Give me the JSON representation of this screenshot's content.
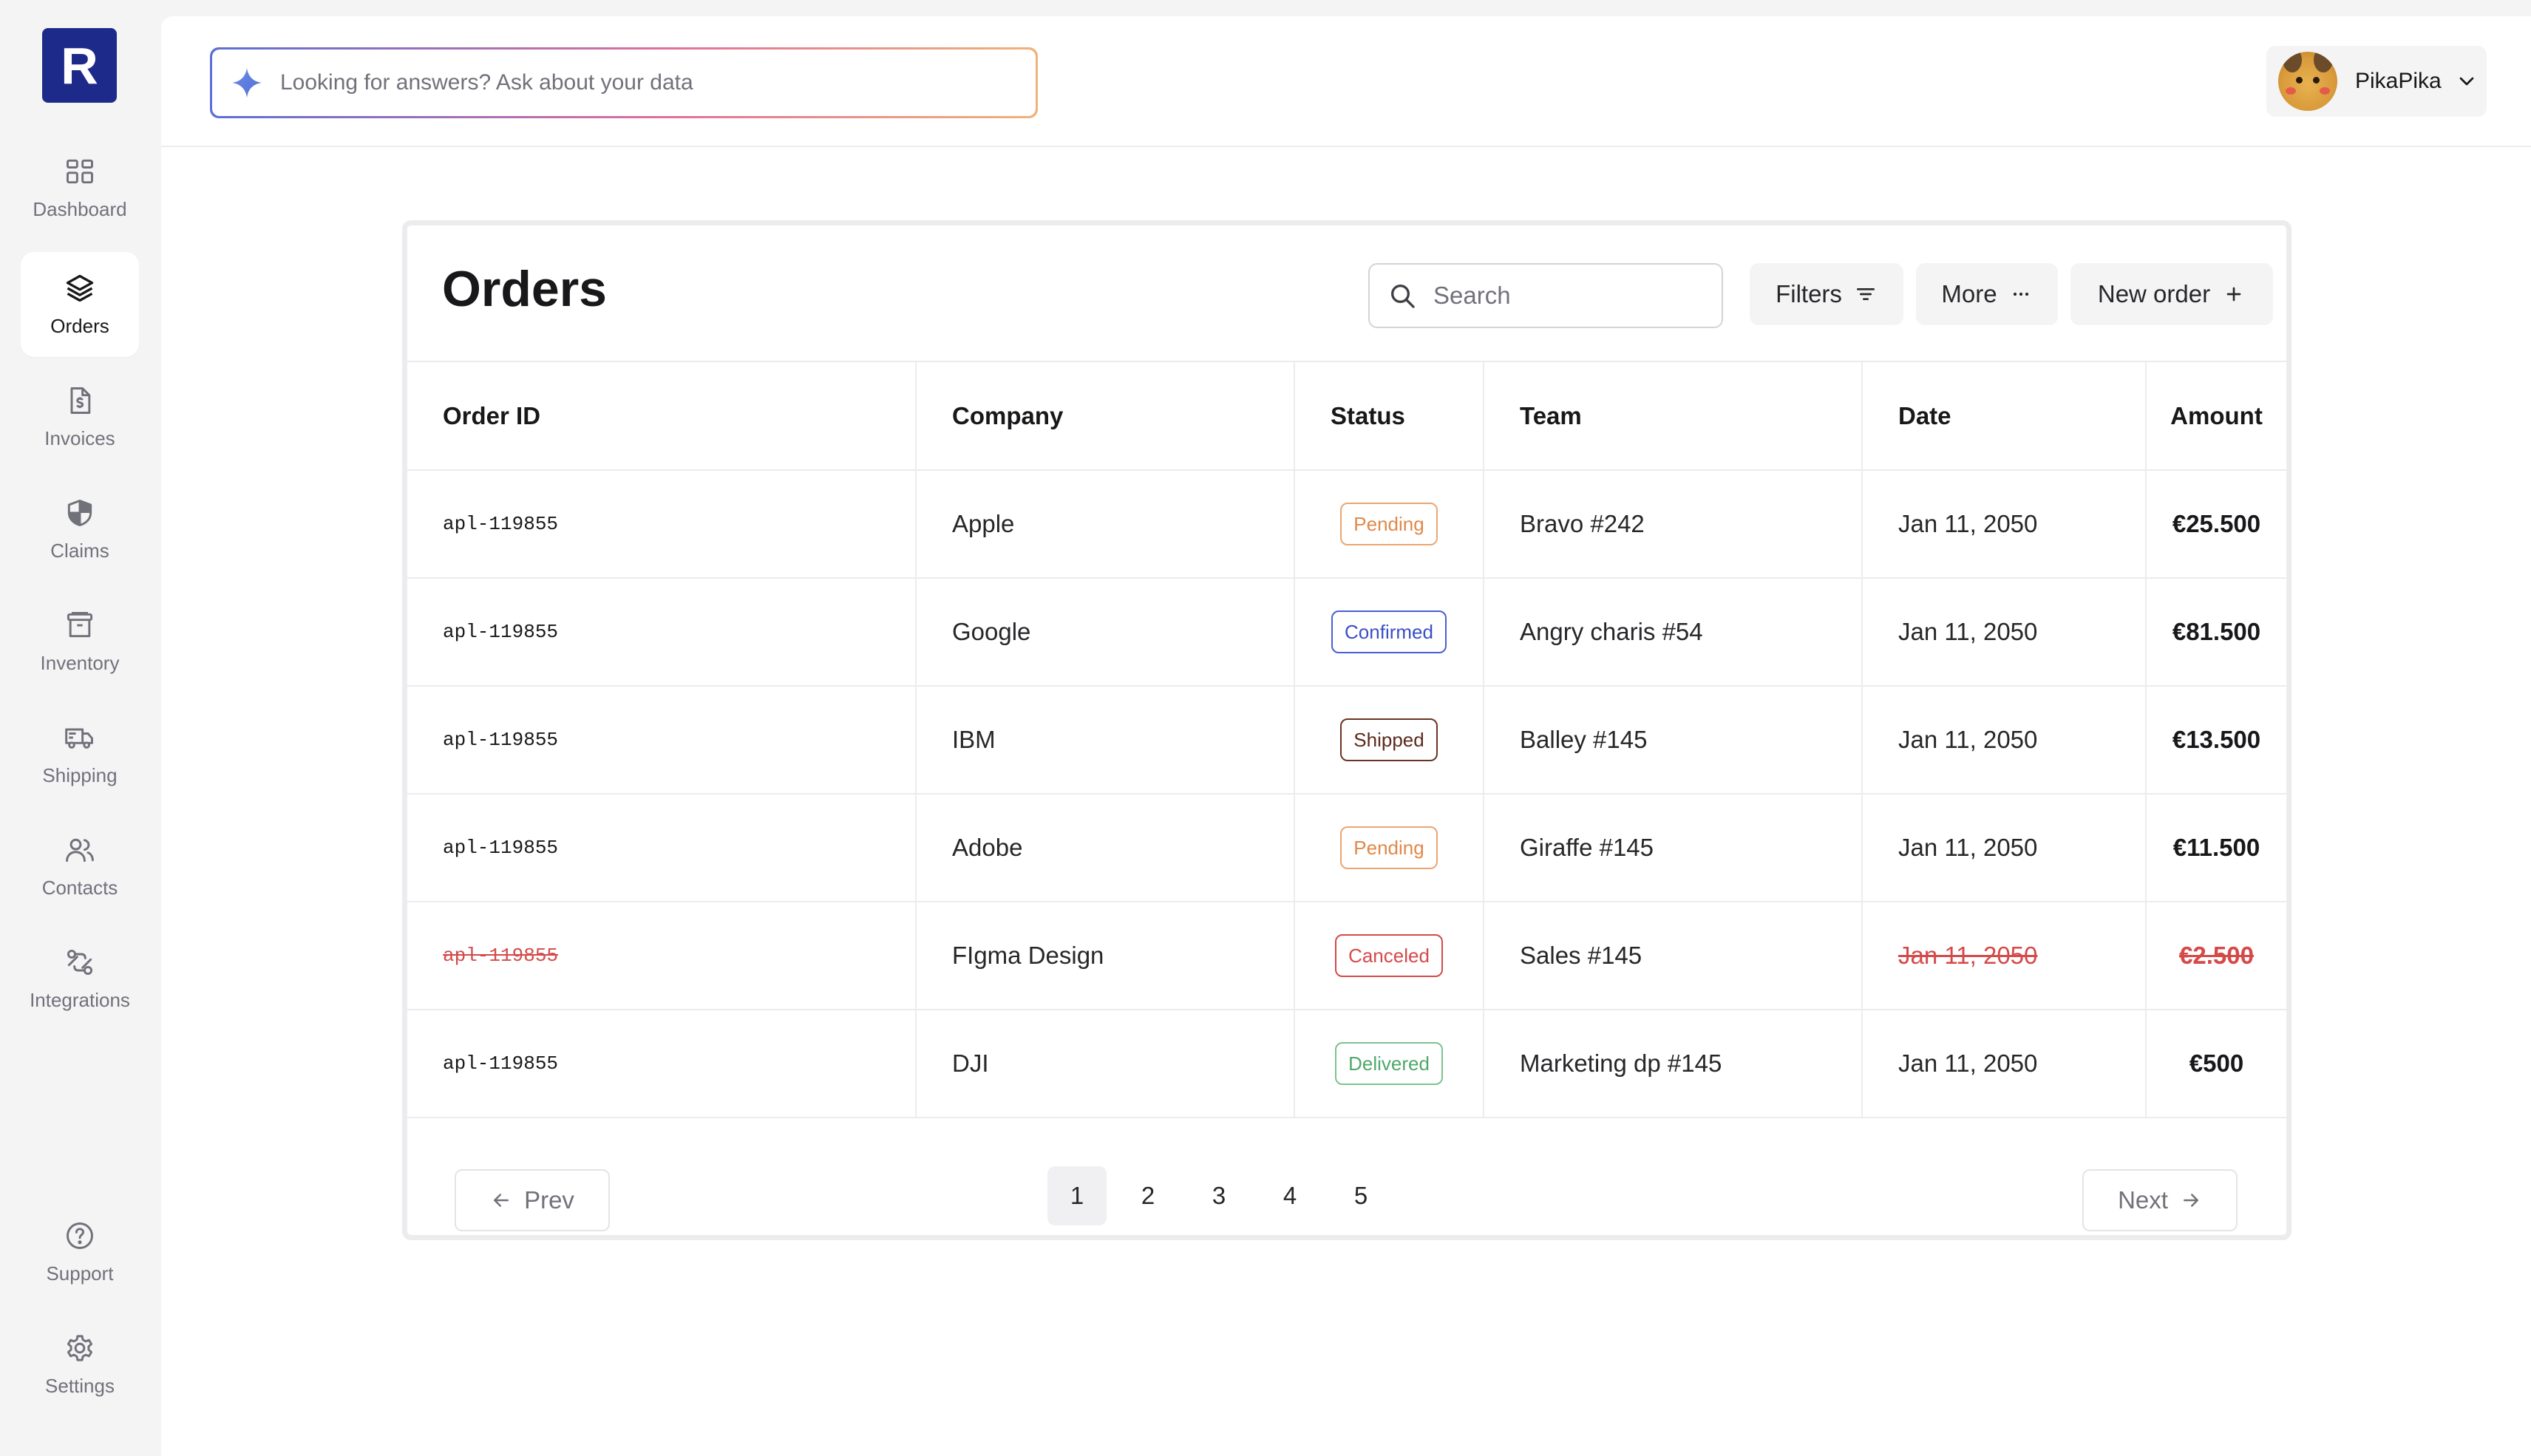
{
  "logo": {
    "letter": "R"
  },
  "sidebar": {
    "items": [
      {
        "id": "dashboard",
        "label": "Dashboard",
        "icon": "dashboard-icon",
        "active": false
      },
      {
        "id": "orders",
        "label": "Orders",
        "icon": "layers-icon",
        "active": true
      },
      {
        "id": "invoices",
        "label": "Invoices",
        "icon": "invoice-icon",
        "active": false
      },
      {
        "id": "claims",
        "label": "Claims",
        "icon": "shield-icon",
        "active": false
      },
      {
        "id": "inventory",
        "label": "Inventory",
        "icon": "archive-icon",
        "active": false
      },
      {
        "id": "shipping",
        "label": "Shipping",
        "icon": "truck-icon",
        "active": false
      },
      {
        "id": "contacts",
        "label": "Contacts",
        "icon": "users-icon",
        "active": false
      },
      {
        "id": "integrations",
        "label": "Integrations",
        "icon": "integration-icon",
        "active": false
      }
    ],
    "bottom": [
      {
        "id": "support",
        "label": "Support",
        "icon": "help-circle-icon"
      },
      {
        "id": "settings",
        "label": "Settings",
        "icon": "gear-icon"
      }
    ]
  },
  "topbar": {
    "ask_placeholder": "Looking for answers? Ask about your data",
    "user_name": "PikaPika"
  },
  "orders": {
    "title": "Orders",
    "search_placeholder": "Search",
    "filters_label": "Filters",
    "more_label": "More",
    "new_order_label": "New order",
    "columns": [
      "Order ID",
      "Company",
      "Status",
      "Team",
      "Date",
      "Amount"
    ],
    "rows": [
      {
        "order_id": "apl-119855",
        "company": "Apple",
        "status": "Pending",
        "team": "Bravo #242",
        "date": "Jan 11, 2050",
        "amount": "€25.500"
      },
      {
        "order_id": "apl-119855",
        "company": "Google",
        "status": "Confirmed",
        "team": "Angry charis #54",
        "date": "Jan 11, 2050",
        "amount": "€81.500"
      },
      {
        "order_id": "apl-119855",
        "company": "IBM",
        "status": "Shipped",
        "team": "Balley #145",
        "date": "Jan 11, 2050",
        "amount": "€13.500"
      },
      {
        "order_id": "apl-119855",
        "company": "Adobe",
        "status": "Pending",
        "team": "Giraffe #145",
        "date": "Jan 11, 2050",
        "amount": "€11.500"
      },
      {
        "order_id": "apl-119855",
        "company": "FIgma Design",
        "status": "Canceled",
        "team": "Sales #145",
        "date": "Jan 11, 2050",
        "amount": "€2.500"
      },
      {
        "order_id": "apl-119855",
        "company": "DJI",
        "status": "Delivered",
        "team": "Marketing dp #145",
        "date": "Jan 11, 2050",
        "amount": "€500"
      }
    ],
    "status_colors": {
      "Pending": {
        "text": "#e0894a",
        "border": "#eba572"
      },
      "Confirmed": {
        "text": "#3b4fc4",
        "border": "#4a5fd0"
      },
      "Shipped": {
        "text": "#5c2a1c",
        "border": "#6b3322"
      },
      "Canceled": {
        "text": "#d44a4a",
        "border": "#d44a4a"
      },
      "Delivered": {
        "text": "#4fa86a",
        "border": "#7cc292"
      }
    },
    "pagination": {
      "prev_label": "Prev",
      "next_label": "Next",
      "pages": [
        "1",
        "2",
        "3",
        "4",
        "5"
      ],
      "current": "1"
    }
  }
}
